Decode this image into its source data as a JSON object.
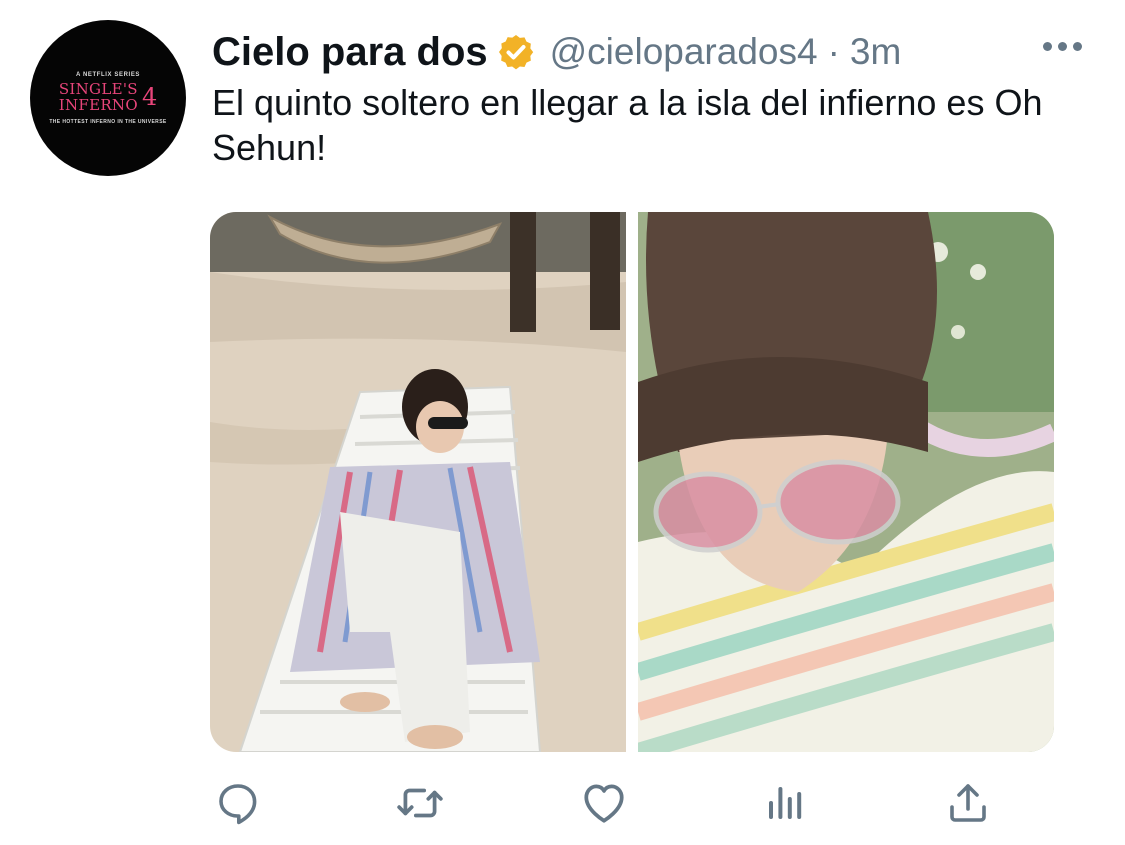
{
  "tweet": {
    "author": {
      "display_name": "Cielo para dos",
      "handle": "@cieloparados4",
      "verified": true,
      "verified_badge_color": "#f2b227",
      "avatar": {
        "netflix_line": "A NETFLIX SERIES",
        "logo_line1": "SINGLE'S",
        "logo_line2": "INFERNO",
        "logo_number": "4",
        "tagline": "THE HOTTEST INFERNO IN THE UNIVERSE",
        "logo_color": "#e8457a"
      }
    },
    "separator": "·",
    "timestamp": "3m",
    "text": "El quinto soltero en llegar a la isla del infierno es Oh Sehun!",
    "media": [
      {
        "description_icon": "photo-beach-lounger"
      },
      {
        "description_icon": "photo-closeup-sunglasses"
      }
    ],
    "actions": [
      {
        "name": "reply",
        "icon": "reply-icon"
      },
      {
        "name": "retweet",
        "icon": "retweet-icon"
      },
      {
        "name": "like",
        "icon": "heart-icon"
      },
      {
        "name": "analytics",
        "icon": "analytics-icon"
      },
      {
        "name": "share",
        "icon": "share-icon"
      }
    ]
  },
  "colors": {
    "text": "#0f1419",
    "secondary": "#657786"
  }
}
